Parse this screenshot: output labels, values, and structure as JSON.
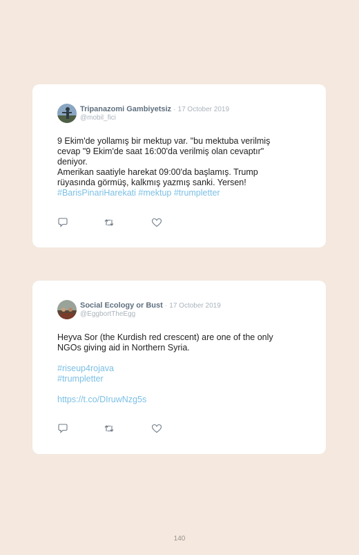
{
  "tweets": [
    {
      "display_name": "Tripanazomi Gambiyetsiz",
      "separator": "·",
      "date": "17 October 2019",
      "handle": "@mobil_fici",
      "lines": [
        "9 Ekim'de yollamış bir mektup var. \"bu mektuba verilmiş",
        "cevap \"9 Ekim'de saat 16:00'da verilmiş olan cevaptır\"",
        "deniyor.",
        "Amerikan saatiyle harekat 09:00'da başlamış. Trump",
        "rüyasında görmüş, kalkmış yazmış sanki. Yersen!"
      ],
      "hashtags": [
        "#BarisPinariHarekati",
        "#mektup",
        "#trumpletter"
      ]
    },
    {
      "display_name": "Social Ecology or Bust",
      "separator": "·",
      "date": "17 October 2019",
      "handle": "@EggbortTheEgg",
      "lines": [
        "Heyva Sor (the Kurdish red crescent) are one of the only",
        "NGOs giving aid in Northern Syria."
      ],
      "hashtags": [
        "#riseup4rojava",
        "#trumpletter"
      ],
      "link": "https://t.co/DIruwNzg5s"
    }
  ],
  "icons": [
    "reply-icon",
    "retweet-icon",
    "like-icon"
  ],
  "page_number": "140"
}
